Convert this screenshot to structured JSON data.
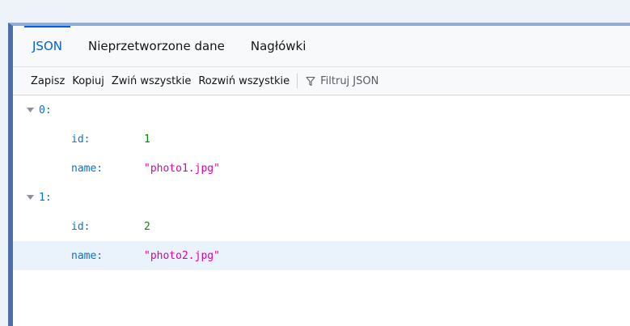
{
  "tabs": [
    {
      "label": "JSON",
      "active": true
    },
    {
      "label": "Nieprzetworzone dane",
      "active": false
    },
    {
      "label": "Nagłówki",
      "active": false
    }
  ],
  "toolbar": {
    "save": "Zapisz",
    "copy": "Kopiuj",
    "collapse_all": "Zwiń wszystkie",
    "expand_all": "Rozwiń wszystkie",
    "filter_placeholder": "Filtruj JSON"
  },
  "tree": {
    "items": [
      {
        "key": "0:",
        "expanded": true,
        "props": [
          {
            "key": "id:",
            "value": "1",
            "type": "number"
          },
          {
            "key": "name:",
            "value": "\"photo1.jpg\"",
            "type": "string"
          }
        ]
      },
      {
        "key": "1:",
        "expanded": true,
        "props": [
          {
            "key": "id:",
            "value": "2",
            "type": "number"
          },
          {
            "key": "name:",
            "value": "\"photo2.jpg\"",
            "type": "string",
            "selected": true
          }
        ]
      }
    ]
  },
  "colors": {
    "accent": "#0060df",
    "key": "#0074e8",
    "number": "#058b00",
    "string": "#dd00a9",
    "selected_row": "#eaf2fb"
  },
  "icons": {
    "filter": "filter-icon",
    "expand": "triangle-down-icon"
  }
}
